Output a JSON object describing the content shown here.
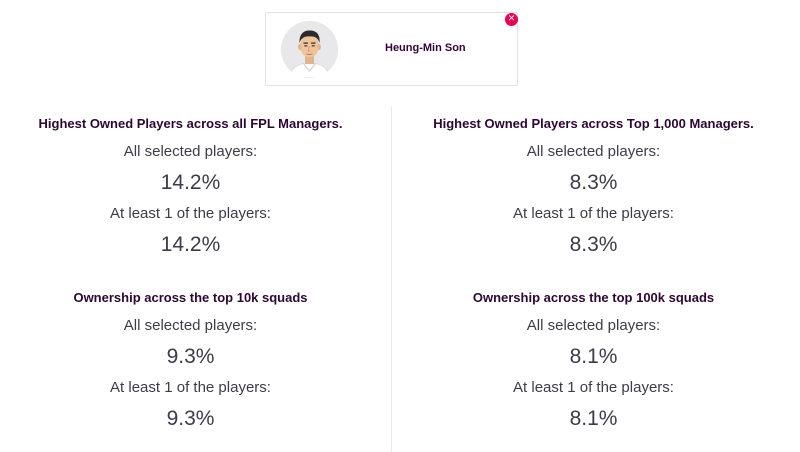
{
  "player": {
    "name": "Heung-Min Son",
    "remove_glyph": "✕",
    "avatar_icon": "player-avatar"
  },
  "stats": {
    "all_managers": {
      "title": "Highest Owned Players across all FPL Managers.",
      "all_selected_label": "All selected players:",
      "all_selected_value": "14.2%",
      "at_least_one_label": "At least 1 of the players:",
      "at_least_one_value": "14.2%"
    },
    "top_1000": {
      "title": "Highest Owned Players across Top 1,000 Managers.",
      "all_selected_label": "All selected players:",
      "all_selected_value": "8.3%",
      "at_least_one_label": "At least 1 of the players:",
      "at_least_one_value": "8.3%"
    },
    "top_10k": {
      "title": "Ownership across the top 10k squads",
      "all_selected_label": "All selected players:",
      "all_selected_value": "9.3%",
      "at_least_one_label": "At least 1 of the players:",
      "at_least_one_value": "9.3%"
    },
    "top_100k": {
      "title": "Ownership across the top 100k squads",
      "all_selected_label": "All selected players:",
      "all_selected_value": "8.1%",
      "at_least_one_label": "At least 1 of the players:",
      "at_least_one_value": "8.1%"
    }
  },
  "colors": {
    "accent_remove": "#e90052",
    "heading": "#2d0733",
    "text": "#3c3c4a"
  }
}
